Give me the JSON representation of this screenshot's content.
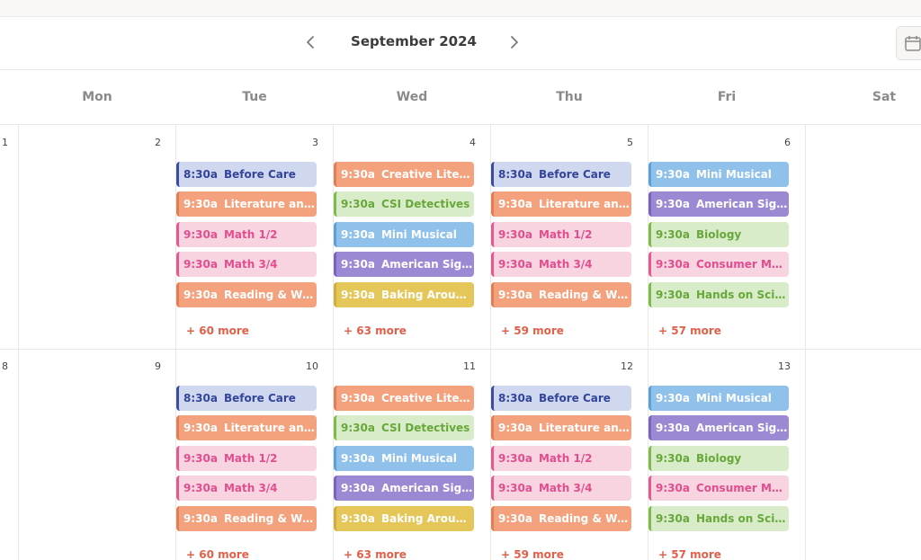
{
  "header": {
    "month_title": "September 2024"
  },
  "weekdays": [
    "Mon",
    "Tue",
    "Wed",
    "Thu",
    "Fri",
    "Sat"
  ],
  "colors": {
    "blue": {
      "bg": "#cfd8ee",
      "border": "#3a4d9e",
      "text": "#33459a"
    },
    "orange": {
      "bg": "#f3a27d",
      "border": "#e07f55",
      "text": "#ffffff"
    },
    "pink": {
      "bg": "#f8d4e0",
      "border": "#e25a93",
      "text": "#e04e8f"
    },
    "green": {
      "bg": "#d8ecc9",
      "border": "#7cba4a",
      "text": "#68a83a"
    },
    "sky": {
      "bg": "#8fc1ea",
      "border": "#5aa0da",
      "text": "#ffffff"
    },
    "purple": {
      "bg": "#9c89d3",
      "border": "#7863c2",
      "text": "#ffffff"
    },
    "yellow": {
      "bg": "#e4c659",
      "border": "#cfae3e",
      "text": "#ffffff"
    }
  },
  "weeks": [
    {
      "days": [
        {
          "num": "1",
          "events": [],
          "more": ""
        },
        {
          "num": "2",
          "events": [],
          "more": ""
        },
        {
          "num": "3",
          "more": "+ 60 more",
          "events": [
            {
              "time": "8:30a",
              "title": "Before Care",
              "color": "blue"
            },
            {
              "time": "9:30a",
              "title": "Literature and W...",
              "color": "orange"
            },
            {
              "time": "9:30a",
              "title": "Math 1/2",
              "color": "pink"
            },
            {
              "time": "9:30a",
              "title": "Math 3/4",
              "color": "pink"
            },
            {
              "time": "9:30a",
              "title": "Reading & Writin...",
              "color": "orange"
            }
          ]
        },
        {
          "num": "4",
          "more": "+ 63 more",
          "events": [
            {
              "time": "9:30a",
              "title": "Creative Literary...",
              "color": "orange"
            },
            {
              "time": "9:30a",
              "title": "CSI Detectives",
              "color": "green"
            },
            {
              "time": "9:30a",
              "title": "Mini Musical",
              "color": "sky"
            },
            {
              "time": "9:30a",
              "title": "American Sign L...",
              "color": "purple"
            },
            {
              "time": "9:30a",
              "title": "Baking Around t...",
              "color": "yellow"
            }
          ]
        },
        {
          "num": "5",
          "more": "+ 59 more",
          "events": [
            {
              "time": "8:30a",
              "title": "Before Care",
              "color": "blue"
            },
            {
              "time": "9:30a",
              "title": "Literature and W...",
              "color": "orange"
            },
            {
              "time": "9:30a",
              "title": "Math 1/2",
              "color": "pink"
            },
            {
              "time": "9:30a",
              "title": "Math 3/4",
              "color": "pink"
            },
            {
              "time": "9:30a",
              "title": "Reading & Writin...",
              "color": "orange"
            }
          ]
        },
        {
          "num": "6",
          "more": "+ 57 more",
          "events": [
            {
              "time": "9:30a",
              "title": "Mini Musical",
              "color": "sky"
            },
            {
              "time": "9:30a",
              "title": "American Sign L...",
              "color": "purple"
            },
            {
              "time": "9:30a",
              "title": "Biology",
              "color": "green"
            },
            {
              "time": "9:30a",
              "title": "Consumer Math",
              "color": "pink"
            },
            {
              "time": "9:30a",
              "title": "Hands on Scienc...",
              "color": "green"
            }
          ]
        },
        {
          "num": "",
          "events": [],
          "more": ""
        }
      ]
    },
    {
      "days": [
        {
          "num": "8",
          "events": [],
          "more": ""
        },
        {
          "num": "9",
          "events": [],
          "more": ""
        },
        {
          "num": "10",
          "more": "+ 60 more",
          "events": [
            {
              "time": "8:30a",
              "title": "Before Care",
              "color": "blue"
            },
            {
              "time": "9:30a",
              "title": "Literature and W...",
              "color": "orange"
            },
            {
              "time": "9:30a",
              "title": "Math 1/2",
              "color": "pink"
            },
            {
              "time": "9:30a",
              "title": "Math 3/4",
              "color": "pink"
            },
            {
              "time": "9:30a",
              "title": "Reading & Writin...",
              "color": "orange"
            }
          ]
        },
        {
          "num": "11",
          "more": "+ 63 more",
          "events": [
            {
              "time": "9:30a",
              "title": "Creative Literary...",
              "color": "orange"
            },
            {
              "time": "9:30a",
              "title": "CSI Detectives",
              "color": "green"
            },
            {
              "time": "9:30a",
              "title": "Mini Musical",
              "color": "sky"
            },
            {
              "time": "9:30a",
              "title": "American Sign L...",
              "color": "purple"
            },
            {
              "time": "9:30a",
              "title": "Baking Around t...",
              "color": "yellow"
            }
          ]
        },
        {
          "num": "12",
          "more": "+ 59 more",
          "events": [
            {
              "time": "8:30a",
              "title": "Before Care",
              "color": "blue"
            },
            {
              "time": "9:30a",
              "title": "Literature and W...",
              "color": "orange"
            },
            {
              "time": "9:30a",
              "title": "Math 1/2",
              "color": "pink"
            },
            {
              "time": "9:30a",
              "title": "Math 3/4",
              "color": "pink"
            },
            {
              "time": "9:30a",
              "title": "Reading & Writin...",
              "color": "orange"
            }
          ]
        },
        {
          "num": "13",
          "more": "+ 57 more",
          "events": [
            {
              "time": "9:30a",
              "title": "Mini Musical",
              "color": "sky"
            },
            {
              "time": "9:30a",
              "title": "American Sign L...",
              "color": "purple"
            },
            {
              "time": "9:30a",
              "title": "Biology",
              "color": "green"
            },
            {
              "time": "9:30a",
              "title": "Consumer Math",
              "color": "pink"
            },
            {
              "time": "9:30a",
              "title": "Hands on Scienc...",
              "color": "green"
            }
          ]
        },
        {
          "num": "",
          "events": [],
          "more": ""
        }
      ]
    }
  ]
}
